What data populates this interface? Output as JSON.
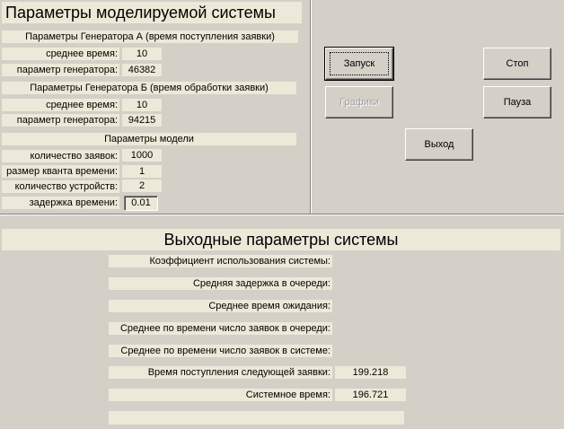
{
  "system_params": {
    "title": "Параметры моделируемой системы",
    "gen_a": {
      "header": "Параметры Генератора А (время поступления заявки)",
      "mean_label": "среднее время:",
      "mean_value": "10",
      "param_label": "параметр генератора:",
      "param_value": "46382"
    },
    "gen_b": {
      "header": "Параметры Генератора Б (время обработки заявки)",
      "mean_label": "среднее время:",
      "mean_value": "10",
      "param_label": "параметр генератора:",
      "param_value": "94215"
    },
    "model": {
      "header": "Параметры модели",
      "requests_label": "количество заявок:",
      "requests_value": "1000",
      "quantum_label": "размер кванта времени:",
      "quantum_value": "1",
      "devices_label": "количество устройств:",
      "devices_value": "2",
      "delay_label": "задержка времени:",
      "delay_value": "0.01"
    }
  },
  "buttons": {
    "start": "Запуск",
    "stop": "Стоп",
    "charts": "Графики",
    "pause": "Пауза",
    "exit": "Выход"
  },
  "output": {
    "title": "Выходные параметры системы",
    "rows": [
      {
        "label": "Коэффициент использования системы:",
        "value": ""
      },
      {
        "label": "Средняя задержка в очереди:",
        "value": ""
      },
      {
        "label": "Среднее время ожидания:",
        "value": ""
      },
      {
        "label": "Среднее по времени число заявок в очереди:",
        "value": ""
      },
      {
        "label": "Среднее по времени число заявок в системе:",
        "value": ""
      },
      {
        "label": "Время поступления следующей заявки:",
        "value": "199.218"
      },
      {
        "label": "Системное время:",
        "value": "196.721"
      }
    ],
    "status": ""
  }
}
